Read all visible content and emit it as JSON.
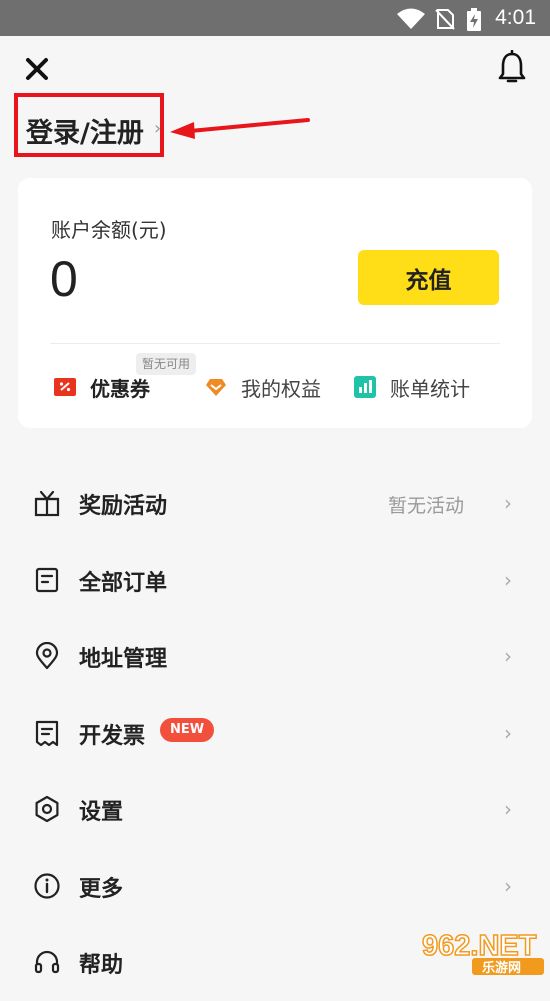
{
  "status_bar": {
    "time": "4:01"
  },
  "header": {
    "login_label": "登录/注册",
    "login_chevron": "›"
  },
  "balance": {
    "label": "账户余额(元)",
    "value": "0",
    "recharge_label": "充值",
    "coupon_tag": "暂无可用"
  },
  "shortcuts": [
    {
      "label": "优惠券",
      "icon": "coupon-icon",
      "color": "#e8341c"
    },
    {
      "label": "我的权益",
      "icon": "rights-icon",
      "color": "#f08a24"
    },
    {
      "label": "账单统计",
      "icon": "bill-stats-icon",
      "color": "#1fc3a8"
    }
  ],
  "menu": [
    {
      "label": "奖励活动",
      "icon": "gift-icon",
      "extra": "暂无活动",
      "chevron": "›"
    },
    {
      "label": "全部订单",
      "icon": "order-icon",
      "chevron": "›"
    },
    {
      "label": "地址管理",
      "icon": "location-icon",
      "chevron": "›"
    },
    {
      "label": "开发票",
      "icon": "invoice-icon",
      "badge": "NEW",
      "chevron": "›"
    },
    {
      "label": "设置",
      "icon": "settings-icon",
      "chevron": "›"
    },
    {
      "label": "更多",
      "icon": "info-icon",
      "chevron": "›"
    },
    {
      "label": "帮助",
      "icon": "headset-icon",
      "chevron": "›"
    }
  ],
  "watermark": {
    "text": "962.NET",
    "subtext": "乐游网"
  },
  "colors": {
    "accent_yellow": "#ffdd17",
    "highlight_red": "#e8151b",
    "badge_red": "#f2503d"
  }
}
